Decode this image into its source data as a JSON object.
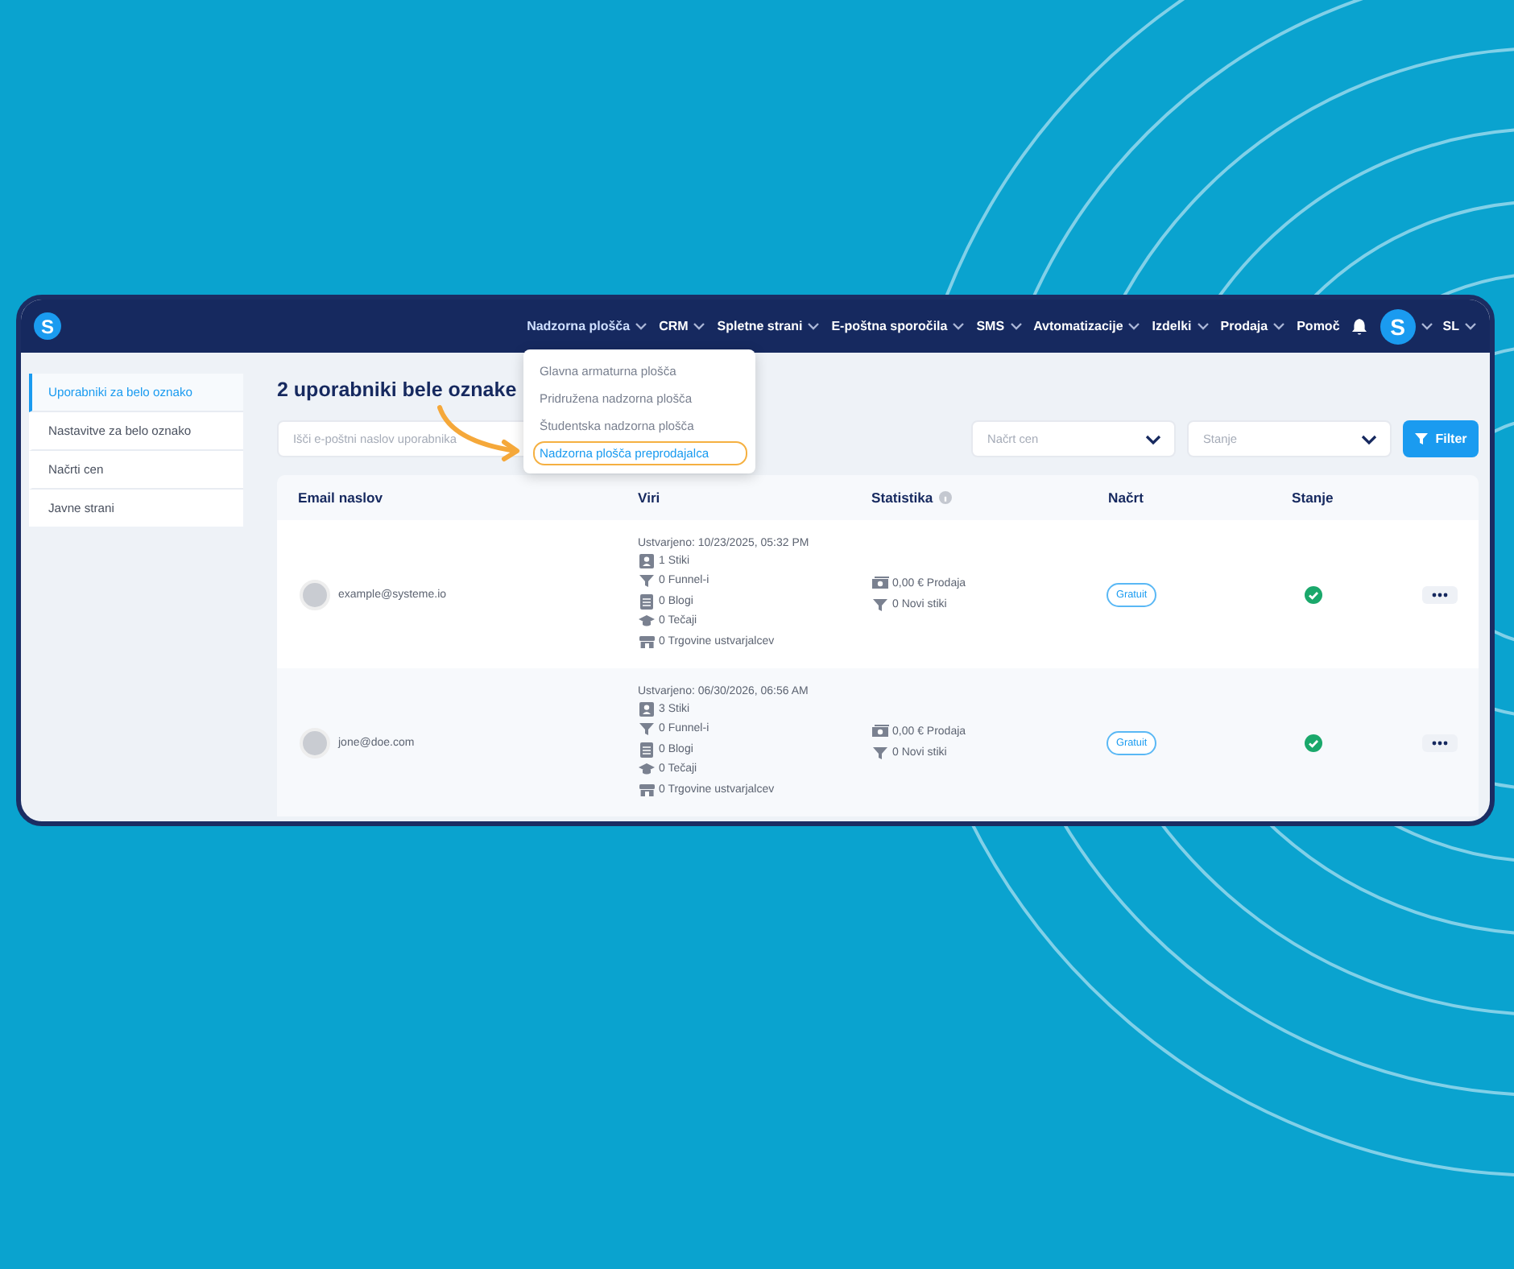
{
  "logo": {
    "letter": "S"
  },
  "nav": {
    "items": [
      {
        "label": "Nadzorna plošča",
        "dropdown": true,
        "expanded": true
      },
      {
        "label": "CRM",
        "dropdown": true,
        "expanded": false
      },
      {
        "label": "Spletne strani",
        "dropdown": true,
        "expanded": false
      },
      {
        "label": "E-poštna sporočila",
        "dropdown": true,
        "expanded": false
      },
      {
        "label": "SMS",
        "dropdown": true,
        "expanded": false
      },
      {
        "label": "Avtomatizacije",
        "dropdown": true,
        "expanded": false
      },
      {
        "label": "Izdelki",
        "dropdown": true,
        "expanded": false
      },
      {
        "label": "Prodaja",
        "dropdown": true,
        "expanded": false
      },
      {
        "label": "Pomoč",
        "dropdown": false,
        "expanded": false
      }
    ],
    "avatar": {
      "letter": "S"
    },
    "language": "SL"
  },
  "nav_menu": {
    "items": [
      {
        "label": "Glavna armaturna plošča",
        "highlighted": false
      },
      {
        "label": "Pridružena nadzorna plošča",
        "highlighted": false
      },
      {
        "label": "Študentska nadzorna plošča",
        "highlighted": false
      },
      {
        "label": "Nadzorna plošča preprodajalca",
        "highlighted": true
      }
    ]
  },
  "sidebar": {
    "items": [
      {
        "label": "Uporabniki za belo oznako",
        "selected": true
      },
      {
        "label": "Nastavitve za belo oznako",
        "selected": false
      },
      {
        "label": "Načrti cen",
        "selected": false
      },
      {
        "label": "Javne strani",
        "selected": false
      }
    ]
  },
  "title": "2 uporabniki bele oznake",
  "search": {
    "placeholder": "Išči e-poštni naslov uporabnika"
  },
  "filters": [
    {
      "placeholder": "Načrt cen"
    },
    {
      "placeholder": "Stanje"
    }
  ],
  "filter_button": "Filter",
  "table": {
    "columns": [
      {
        "label": "Email naslov",
        "info": false
      },
      {
        "label": "Viri",
        "info": false
      },
      {
        "label": "Statistika",
        "info": true
      },
      {
        "label": "Načrt",
        "info": false
      },
      {
        "label": "Stanje",
        "info": false
      }
    ],
    "rows": [
      {
        "email": "example@systeme.io",
        "created": "Ustvarjeno: 10/23/2025, 05:32 PM",
        "resources": [
          {
            "kind": "contacts",
            "text": "1 Stiki"
          },
          {
            "kind": "funnel",
            "text": "0 Funnel-i"
          },
          {
            "kind": "blog",
            "text": "0 Blogi"
          },
          {
            "kind": "course",
            "text": "0 Tečaji"
          },
          {
            "kind": "store",
            "text": "0 Trgovine ustvarjalcev"
          }
        ],
        "stats": [
          {
            "kind": "money",
            "text": "0,00 € Prodaja"
          },
          {
            "kind": "funnel",
            "text": "0 Novi stiki"
          }
        ],
        "plan": "Gratuit",
        "active": true
      },
      {
        "email": "jone@doe.com",
        "created": "Ustvarjeno: 06/30/2026, 06:56 AM",
        "resources": [
          {
            "kind": "contacts",
            "text": "3 Stiki"
          },
          {
            "kind": "funnel",
            "text": "0 Funnel-i"
          },
          {
            "kind": "blog",
            "text": "0 Blogi"
          },
          {
            "kind": "course",
            "text": "0 Tečaji"
          },
          {
            "kind": "store",
            "text": "0 Trgovine ustvarjalcev"
          }
        ],
        "stats": [
          {
            "kind": "money",
            "text": "0,00 € Prodaja"
          },
          {
            "kind": "funnel",
            "text": "0 Novi stiki"
          }
        ],
        "plan": "Gratuit",
        "active": true
      }
    ]
  }
}
